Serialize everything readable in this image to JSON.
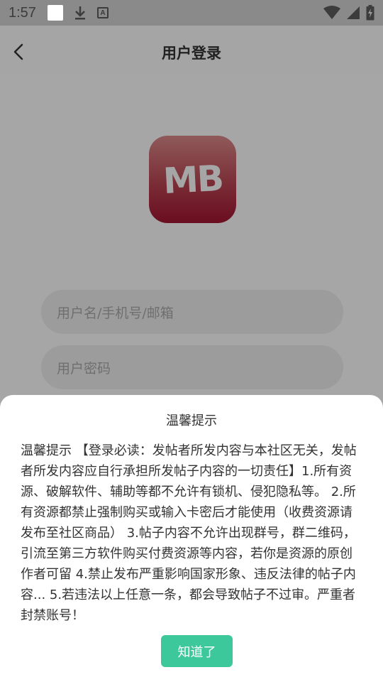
{
  "status_bar": {
    "time": "1:57",
    "icons": [
      "notification-square-icon",
      "download-icon",
      "font-a-icon",
      "wifi-icon",
      "cell-signal-icon",
      "battery-charging-icon"
    ],
    "font_icon_letter": "A"
  },
  "header": {
    "title": "用户登录",
    "back_icon": "chevron-left-icon"
  },
  "logo": {
    "text": "MB",
    "color_top": "#8f5a5a",
    "color_bottom": "#6a0d20"
  },
  "form": {
    "username_placeholder": "用户名/手机号/邮箱",
    "password_placeholder": "用户密码"
  },
  "dialog": {
    "title": "温馨提示",
    "body": "温馨提示 【登录必读：发帖者所发内容与本社区无关，发帖者所发内容应自行承担所发帖子内容的一切责任】1.所有资源、破解软件、辅助等都不允许有锁机、侵犯隐私等。 2.所有资源都禁止强制购买或输入卡密后才能使用（收费资源请发布至社区商品） 3.帖子内容不允许出现群号，群二维码，引流至第三方软件购买付费资源等内容，若你是资源的原创作者可留 4.禁止发布严重影响国家形象、违反法律的帖子内容... 5.若违法以上任意一条，都会导致帖子不过审。严重者封禁账号！",
    "ok_label": "知道了",
    "ok_color": "#3dc89c"
  },
  "colors": {
    "overlay_bg": "#a6a6a6",
    "status_bar_bg": "#8a8a8a"
  }
}
